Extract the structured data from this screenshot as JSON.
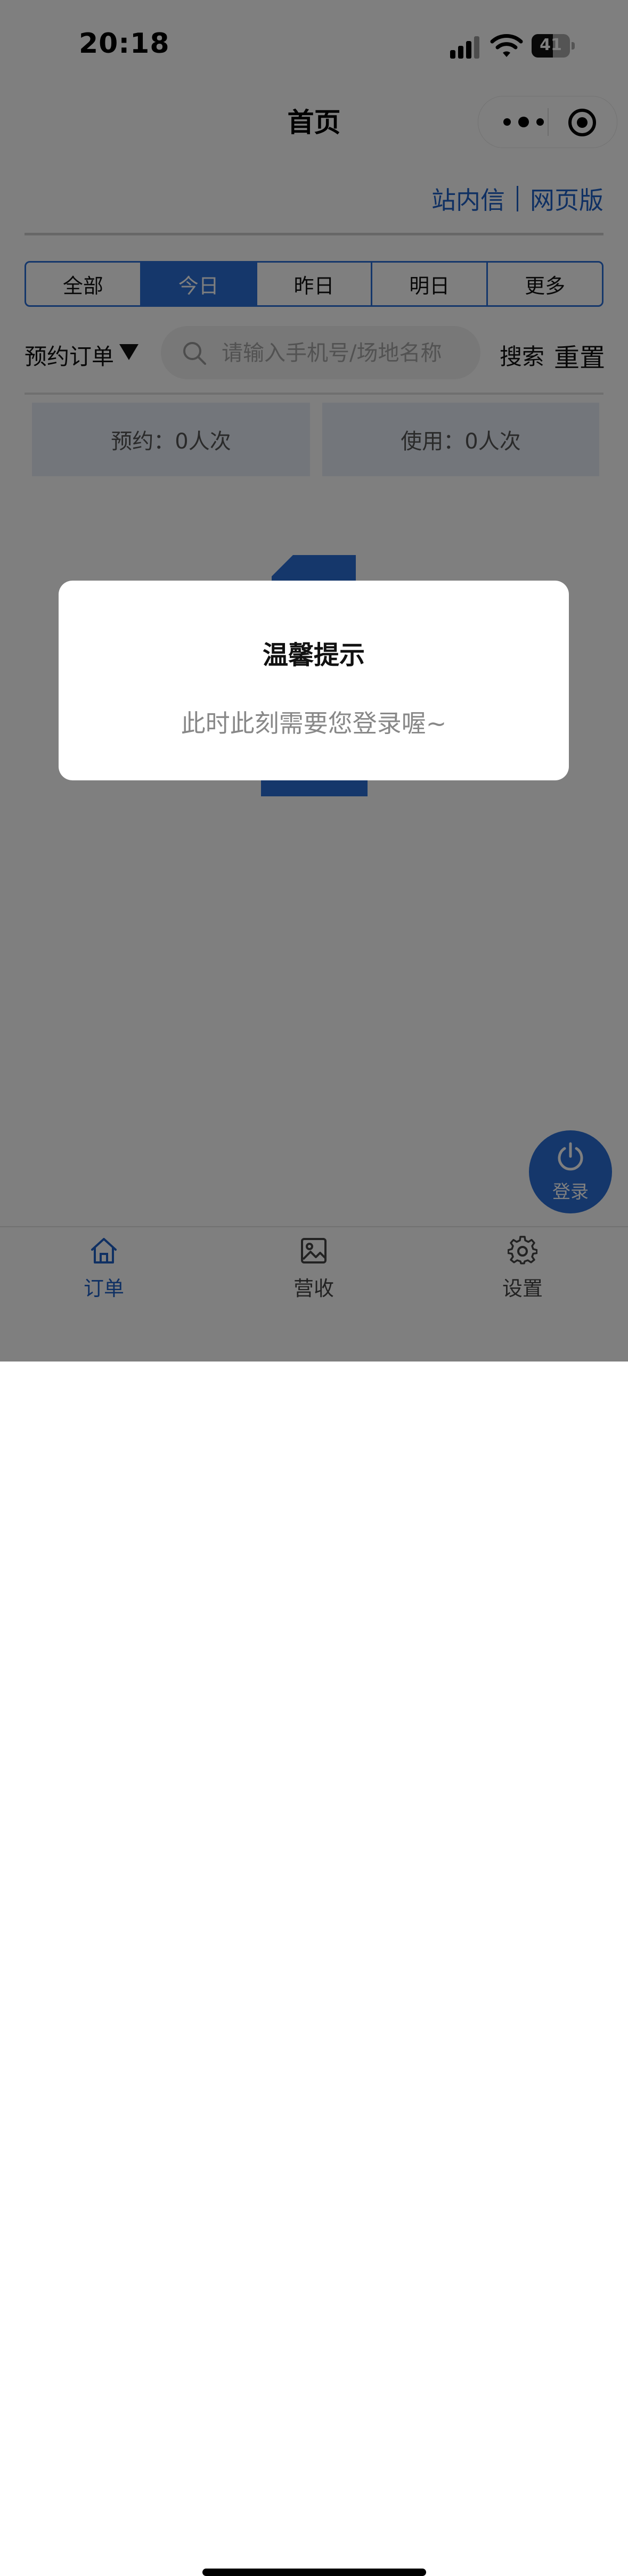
{
  "status_bar": {
    "time": "20:18",
    "battery": "41"
  },
  "nav": {
    "title": "首页"
  },
  "header_links": {
    "inbox": "站内信",
    "web_version": "网页版"
  },
  "date_tabs": [
    {
      "label": "全部",
      "active": false
    },
    {
      "label": "今日",
      "active": true
    },
    {
      "label": "昨日",
      "active": false
    },
    {
      "label": "明日",
      "active": false
    },
    {
      "label": "更多",
      "active": false
    }
  ],
  "filter": {
    "order_type": "预约订单",
    "search_placeholder": "请输入手机号/场地名称",
    "search_label": "搜索",
    "reset_label": "重置"
  },
  "stats": {
    "reserved": "预约：0人次",
    "used": "使用：0人次"
  },
  "fab": {
    "label": "登录"
  },
  "tabbar": [
    {
      "label": "订单",
      "icon": "home-icon",
      "active": true
    },
    {
      "label": "营收",
      "icon": "image-icon",
      "active": false
    },
    {
      "label": "设置",
      "icon": "gear-icon",
      "active": false
    }
  ],
  "dialog": {
    "title": "温馨提示",
    "message": "此时此刻需要您登录喔~"
  },
  "colors": {
    "accent": "#2b6fd6",
    "link": "#1f60c6",
    "overlay": "rgba(0,0,0,0.5)"
  }
}
